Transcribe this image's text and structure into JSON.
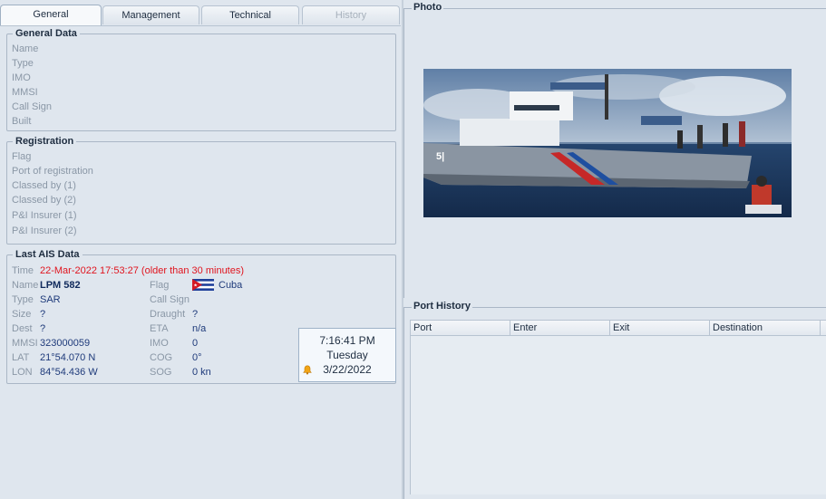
{
  "tabs": [
    {
      "label": "General",
      "state": "active"
    },
    {
      "label": "Management",
      "state": "normal"
    },
    {
      "label": "Technical",
      "state": "normal"
    },
    {
      "label": "History",
      "state": "disabled"
    }
  ],
  "general_data": {
    "title": "General Data",
    "fields": [
      "Name",
      "Type",
      "IMO",
      "MMSI",
      "Call Sign",
      "Built"
    ]
  },
  "registration": {
    "title": "Registration",
    "fields": [
      "Flag",
      "Port of registration",
      "Classed by (1)",
      "Classed by (2)",
      "P&I Insurer (1)",
      "P&I Insurer (2)"
    ]
  },
  "ais": {
    "title": "Last AIS Data",
    "time_label": "Time",
    "time_value": "22-Mar-2022 17:53:27 (older than 30 minutes)",
    "left": [
      {
        "label": "Name",
        "value": "LPM 582"
      },
      {
        "label": "Type",
        "value": "SAR"
      },
      {
        "label": "Size",
        "value": "?"
      },
      {
        "label": "Dest",
        "value": "?"
      },
      {
        "label": "MMSI",
        "value": "323000059"
      },
      {
        "label": "LAT",
        "value": "21°54.070 N"
      },
      {
        "label": "LON",
        "value": "84°54.436 W"
      }
    ],
    "right": [
      {
        "label": "Flag",
        "value": "Cuba"
      },
      {
        "label": "Call Sign",
        "value": ""
      },
      {
        "label": "Draught",
        "value": "?"
      },
      {
        "label": "ETA",
        "value": "n/a"
      },
      {
        "label": "IMO",
        "value": "0"
      },
      {
        "label": "COG",
        "value": "0°"
      },
      {
        "label": "SOG",
        "value": "0 kn"
      }
    ]
  },
  "clock": {
    "time": "7:16:41 PM",
    "day": "Tuesday",
    "date": "3/22/2022"
  },
  "photo_panel": {
    "title": "Photo"
  },
  "port_history": {
    "title": "Port History",
    "columns": [
      "Port",
      "Enter",
      "Exit",
      "Destination"
    ]
  },
  "colors": {
    "background": "#dfe6ee",
    "warning": "#e0141e",
    "value": "#1e3a7a"
  }
}
